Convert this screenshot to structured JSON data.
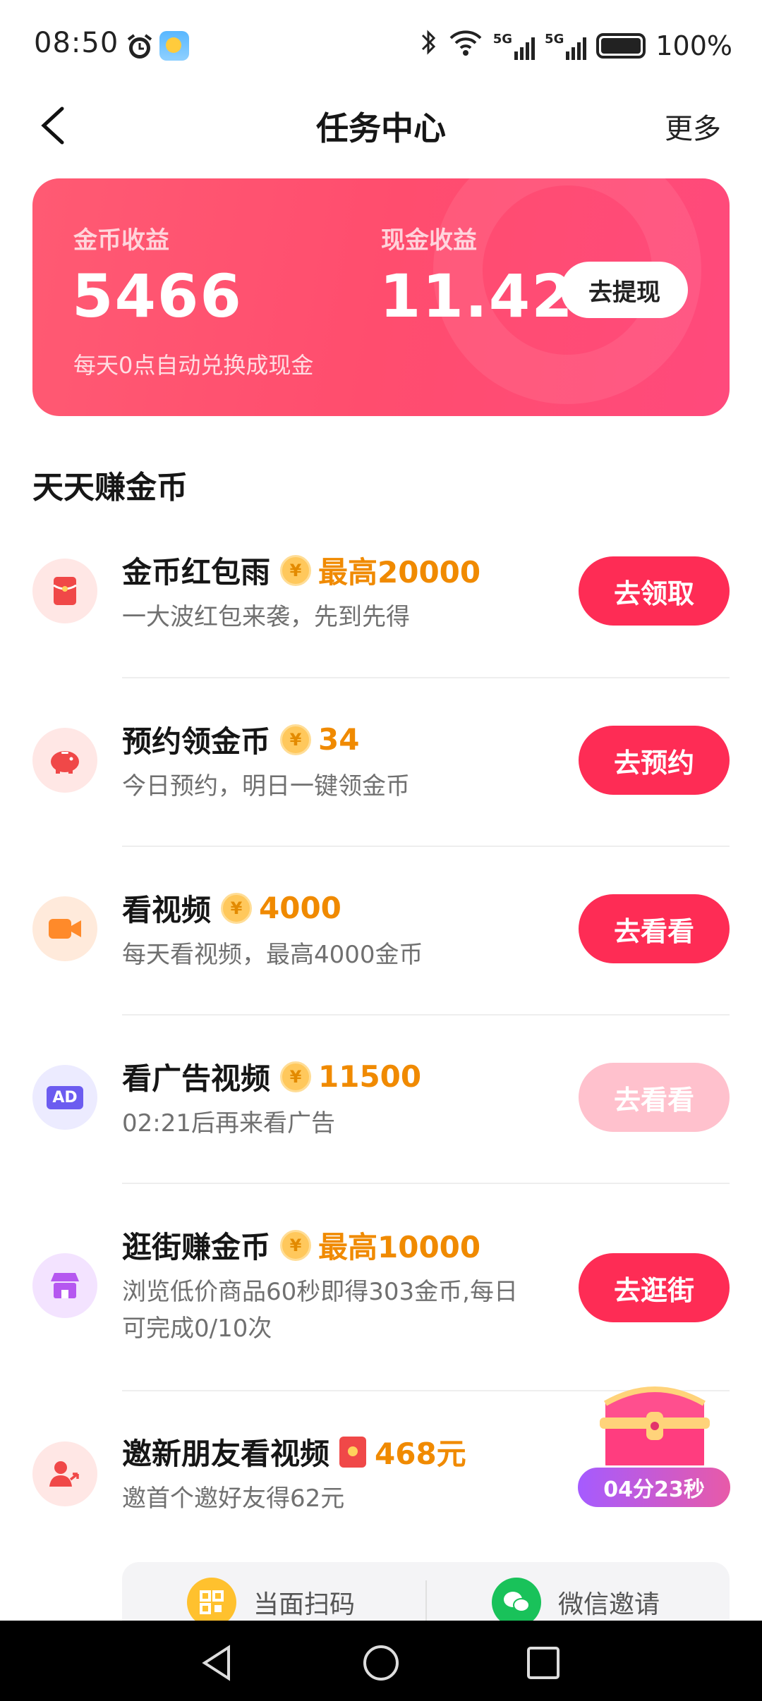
{
  "status_bar": {
    "time": "08:50",
    "battery": "100%",
    "net1": "5G",
    "net2": "5G"
  },
  "header": {
    "title": "任务中心",
    "more": "更多"
  },
  "earnings": {
    "coin_label": "金币收益",
    "coin_value": "5466",
    "cash_label": "现金收益",
    "cash_value": "11.42",
    "withdraw_button": "去提现",
    "note": "每天0点自动兑换成现金"
  },
  "section_title": "天天赚金币",
  "tasks": [
    {
      "title": "金币红包雨",
      "reward": "最高20000",
      "subtitle": "一大波红包来袭，先到先得",
      "button": "去领取",
      "enabled": true,
      "icon": "red-envelope-icon"
    },
    {
      "title": "预约领金币",
      "reward": "34",
      "subtitle": "今日预约，明日一键领金币",
      "button": "去预约",
      "enabled": true,
      "icon": "piggy-bank-icon"
    },
    {
      "title": "看视频",
      "reward": "4000",
      "subtitle": "每天看视频，最高4000金币",
      "button": "去看看",
      "enabled": true,
      "icon": "video-camera-icon"
    },
    {
      "title": "看广告视频",
      "reward": "11500",
      "subtitle": "02:21后再来看广告",
      "button": "去看看",
      "enabled": false,
      "icon": "ad-icon",
      "icon_text": "AD"
    },
    {
      "title": "逛街赚金币",
      "reward": "最高10000",
      "subtitle_line1": "浏览低价商品60秒即得303金币,每日",
      "subtitle_line2": "可完成0/10次",
      "button": "去逛街",
      "enabled": true,
      "icon": "shop-icon"
    },
    {
      "title": "邀新朋友看视频",
      "reward": "468元",
      "subtitle": "邀首个邀好友得62元",
      "icon": "invite-friends-icon"
    }
  ],
  "coin_symbol": "¥",
  "treasure": {
    "timer": "04分23秒"
  },
  "share": {
    "scan": "当面扫码",
    "wechat": "微信邀请"
  },
  "colors": {
    "accent": "#fe2c55",
    "reward": "#f08a00",
    "hero": "#ff5470"
  }
}
